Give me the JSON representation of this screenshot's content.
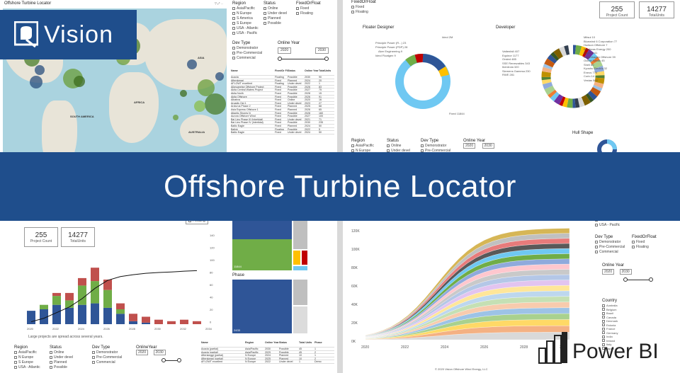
{
  "banner": {
    "title": "Offshore Turbine Locator"
  },
  "logo": {
    "text": "Vision",
    "icon": "q-logo-icon"
  },
  "powerbi": {
    "text": "Power BI",
    "icon": "power-bi-bars-icon"
  },
  "panel1": {
    "title": "Offshore Turbine Locator",
    "region_header": "Region",
    "regions": [
      "Asia/Pacific",
      "N Europe",
      "S America",
      "S Europe",
      "USA - Atlantic",
      "USA - Pacific"
    ],
    "status_header": "Status",
    "statuses": [
      "Online",
      "Under devel",
      "Planned",
      "Possible"
    ],
    "fixed_header": "FixedOrFloat",
    "fixed_options": [
      "Fixed",
      "Floating"
    ],
    "devtype_header": "Dev Type",
    "devtypes": [
      "Demonstrator",
      "Pre-Commercial",
      "Commercial"
    ],
    "online_year_header": "Online Year",
    "year_from": "2020",
    "year_to": "2030",
    "map_labels": [
      "NORTH AMERICA",
      "EUROPE",
      "ASIA",
      "AFRICA",
      "SOUTH AMERICA",
      "AUSTRALIA"
    ],
    "table_headers": [
      "Name",
      "FixedOr Float",
      "Status",
      "Online Year",
      "TotalUnits"
    ],
    "table_rows": [
      [
        "Acacia",
        "Floating",
        "Possible",
        "2030",
        "90"
      ],
      [
        "Afterskeggi",
        "Fixed",
        "Planned",
        "2024",
        "20"
      ],
      [
        "AFLOWT excellent",
        "Floating",
        "Under devel",
        "2022",
        "1"
      ],
      [
        "Aikeuaneise Offshore Project",
        "Fixed",
        "Possible",
        "2026",
        "83"
      ],
      [
        "Akita Central Waters Project",
        "Fixed",
        "Possible",
        "2027",
        "75"
      ],
      [
        "Akita North",
        "Fixed",
        "Possible",
        "2028",
        "15"
      ],
      [
        "Akita Offshore",
        "Fixed",
        "Possible",
        "2026",
        "91"
      ],
      [
        "Albatros",
        "Fixed",
        "Online",
        "2020",
        "16"
      ],
      [
        "Arcadis Ost 1",
        "Fixed",
        "Under devel",
        "2023",
        "27"
      ],
      [
        "Arcturus Phase 2",
        "Fixed",
        "Planned",
        "2025",
        "68"
      ],
      [
        "Asia Express Offshore 1",
        "Fixed",
        "Planned",
        "2026",
        "65"
      ],
      [
        "Atlantic Shores N",
        "Fixed",
        "Possible",
        "2028",
        "160"
      ],
      [
        "Aurora Offshore Wind",
        "Fixed",
        "Possible",
        "2027",
        "100"
      ],
      [
        "Bai Lieu Phase III (Intertidal)",
        "Fixed",
        "Under devel",
        "2021",
        "71"
      ],
      [
        "Bai Lieu Phase IV (Intertidal)",
        "Fixed",
        "Possible",
        "2030",
        "235"
      ],
      [
        "Baltic Eagle",
        "Fixed",
        "Planned",
        "2024",
        "50"
      ],
      [
        "Baltyk",
        "Floating",
        "Possible",
        "2022",
        "5"
      ],
      [
        "Baltic Eagle",
        "Fixed",
        "Under devel",
        "2024",
        "50"
      ]
    ]
  },
  "panel2": {
    "fixed_options": [
      "Fixed",
      "Floating"
    ],
    "fixed_header": "FixedOrFloat",
    "project_count": "255",
    "project_count_label": "Project Count",
    "total_units": "14277",
    "total_units_label": "TotalUnits",
    "floater_designer_title": "Floater Designer",
    "developer_title": "Developer",
    "hull_shape_title": "Hull Shape",
    "floater_labels": [
      "Principle Power (R...) 23",
      "Principle Power (PDP) 28",
      "Aker Engineering 9",
      "Ideol Floatgen 9",
      "Fixed 11844",
      "Ideol 2M"
    ],
    "developer_labels_left": [
      "Vattenfall 407",
      "Equinor 1177",
      "Orsted 485",
      "SSE Renewables 343",
      "Iberdrola 320",
      "Siemens Gamesa 230",
      "RWE 281"
    ],
    "developer_labels_right": [
      "Mitsui 10",
      "Bluewind 6 Corporation 77",
      "Hudson Offshore 7",
      "Brodkeas Energy 200",
      "Equinor 41",
      "Copenhagen Offshore 39",
      "Ocean Winds 45",
      "Shell 60",
      "Kyushu Electric 32",
      "Eneos 770",
      "Corio 14",
      "Vestas 500"
    ],
    "region_header": "Region",
    "regions": [
      "Asia/Pacific",
      "N Europe"
    ],
    "status_header": "Status",
    "statuses": [
      "Online",
      "Under devel"
    ],
    "devtype_header": "Dev Type",
    "devtypes": [
      "Demonstrator",
      "Pre-Commercial"
    ],
    "online_year_header": "Online Year",
    "year_from": "2020",
    "year_to": "2030"
  },
  "panel3": {
    "floating_label": "Floating",
    "project_count": "255",
    "project_count_label": "Project Count",
    "total_units": "14277",
    "total_units_label": "TotalUnits",
    "note": "Large projects are spread across several years.",
    "phase_label": "Phase",
    "left_axis": [
      "100",
      "80",
      "60",
      "40",
      "20",
      "0"
    ],
    "right_axis": [
      "140",
      "120",
      "100",
      "80",
      "60",
      "40",
      "20",
      "0"
    ],
    "x_ticks": [
      "2020",
      "2022",
      "2024",
      "2026",
      "2028",
      "2030",
      "2032",
      "2034"
    ],
    "region_header": "Region",
    "regions": [
      "Asia/Pacific",
      "N Europe",
      "S Europe",
      "USA - Atlantic"
    ],
    "status_header": "Status",
    "statuses": [
      "Online",
      "Under devel",
      "Planned",
      "Possible"
    ],
    "devtype_header": "Dev Type",
    "devtypes": [
      "Demonstrator",
      "Pre-Commercial",
      "Commercial"
    ],
    "online_year_header": "OnlineYear",
    "year_from": "2020",
    "year_to": "2030",
    "table_headers": [
      "Name",
      "Region",
      "Online Year",
      "Status",
      "Total Units",
      "Phase"
    ],
    "table_rows": [
      [
        "Acacia (partial)",
        "Asia/Pacific",
        "2030",
        "Possible",
        "45",
        "1"
      ],
      [
        "Acacia (partial)",
        "Asia/Pacific",
        "2029",
        "Possible",
        "45",
        "2"
      ],
      [
        "Afterskeggi (partial)",
        "N Europe",
        "2024",
        "Planned",
        "10",
        "1"
      ],
      [
        "Afterskeggi (partial)",
        "N Europe",
        "2025",
        "Planned",
        "10",
        "2"
      ],
      [
        "AFLOWT excellent",
        "N Europe",
        "2022",
        "Under devel",
        "1",
        "Demo"
      ]
    ],
    "treemap_values": [
      "11844",
      "73",
      "2433"
    ]
  },
  "panel4": {
    "y_ticks": [
      "120K",
      "100K",
      "80K",
      "60K",
      "40K",
      "20K",
      "0K"
    ],
    "x_ticks": [
      "2020",
      "2022",
      "2024",
      "2026",
      "2028",
      "2030"
    ],
    "regions_partial": [
      "USA - Atlantic",
      "USA - Pacific"
    ],
    "devtype_header": "Dev Type",
    "devtypes": [
      "Demonstrator",
      "Pre-Commercial",
      "Commercial"
    ],
    "fixed_header": "FixedOrFloat",
    "fixed_options": [
      "Fixed",
      "Floating"
    ],
    "online_year_header": "Online Year",
    "year_from": "2020",
    "year_to": "2030",
    "country_header": "Country",
    "countries": [
      "Australia",
      "Belgium",
      "Brazil",
      "Canada",
      "Denmark",
      "Estonia",
      "France",
      "Germany",
      "India",
      "Ireland",
      "Italy",
      "Japan"
    ],
    "footer": "© 2020 Vision Offshore Wind Energy, LLC"
  }
}
